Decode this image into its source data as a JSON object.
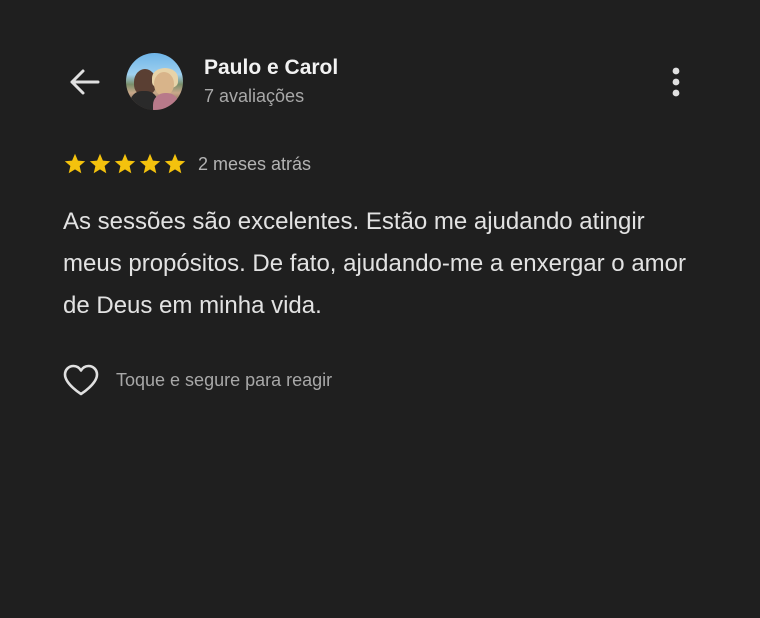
{
  "header": {
    "back_icon": "arrow-left-icon",
    "reviewer_name": "Paulo e Carol",
    "reviewer_reviews": "7 avaliações",
    "more_icon": "more-vertical-icon"
  },
  "review": {
    "rating": 5,
    "rating_max": 5,
    "star_color": "#f4c20d",
    "date": "2 meses atrás",
    "text": "As sessões são excelentes. Estão me ajudando atingir meus propósitos. De fato, ajudando-me a enxergar o amor de Deus em minha vida."
  },
  "reaction": {
    "icon": "heart-outline-icon",
    "label": "Toque e segure para reagir"
  },
  "colors": {
    "background": "#1f1f1f",
    "text_primary": "#f2f2f2",
    "text_secondary": "#a8a8a8"
  }
}
